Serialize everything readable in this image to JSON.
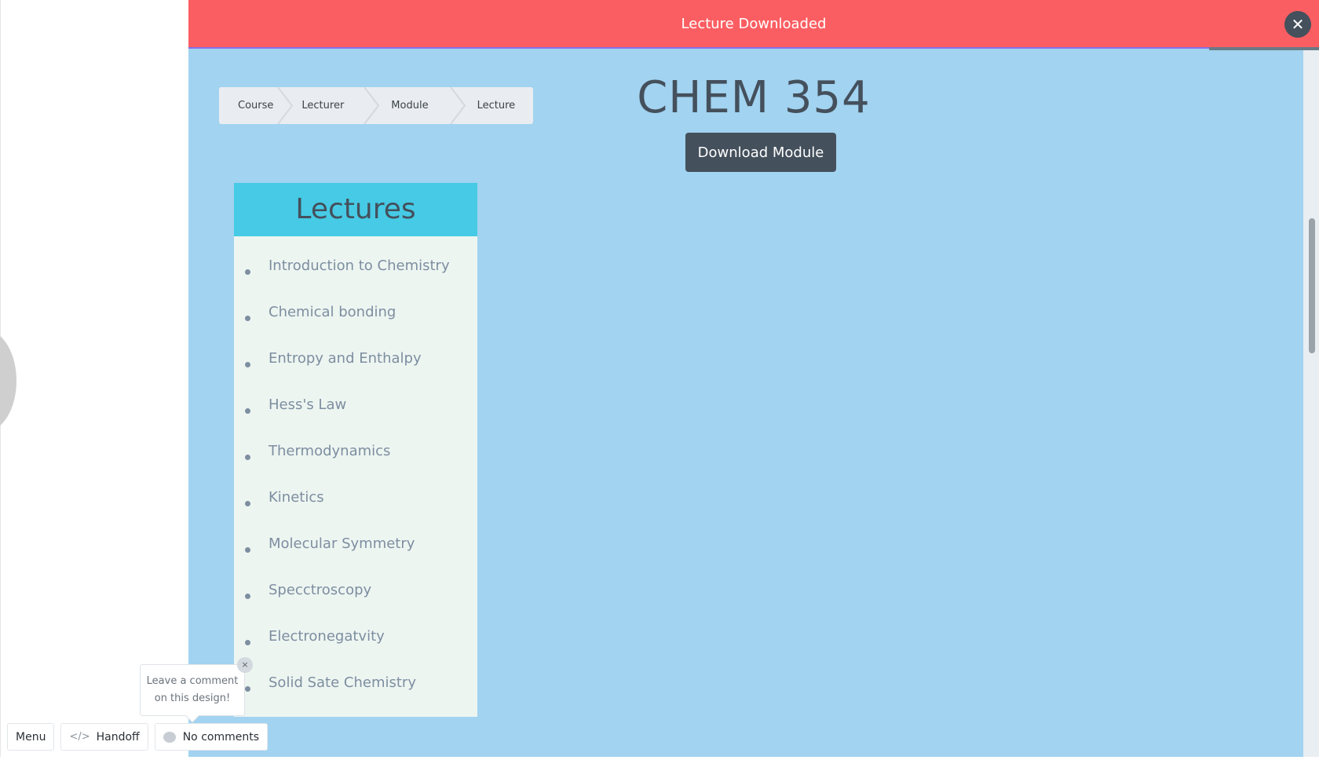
{
  "toast": {
    "title": "Lecture Downloaded",
    "close_symbol": "✕",
    "color": "#fb5e62"
  },
  "breadcrumb": {
    "items": [
      "Course",
      "Lecturer",
      "Module",
      "Lecture"
    ]
  },
  "course": {
    "title": "CHEM 354",
    "download_label": "Download Module"
  },
  "lectures": {
    "heading": "Lectures",
    "items": [
      "Introduction to Chemistry",
      "Chemical bonding",
      "Entropy and Enthalpy",
      "Hess's Law",
      "Thermodynamics",
      "Kinetics",
      "Molecular Symmetry",
      "Specctroscopy",
      "Electronegatvity",
      "Solid Sate Chemistry"
    ]
  },
  "comment_prompt": {
    "line1": "Leave a comment",
    "line2": "on this design!",
    "close_symbol": "×"
  },
  "toolbar": {
    "menu_label": "Menu",
    "handoff_icon": "</>",
    "handoff_label": "Handoff",
    "comments_label": "No comments"
  },
  "colors": {
    "background": "#a2d3f0",
    "accent": "#46cae5",
    "dark": "#44505c"
  }
}
